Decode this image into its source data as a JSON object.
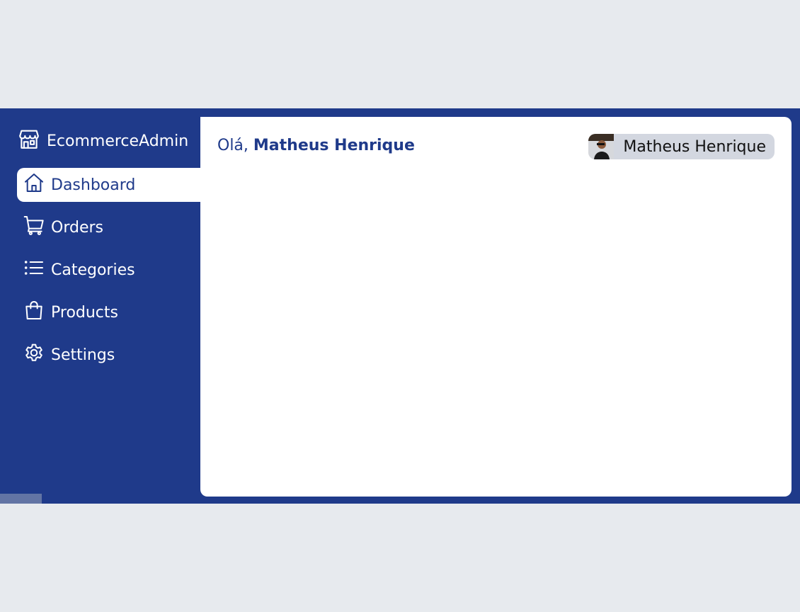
{
  "brand": {
    "name": "EcommerceAdmin",
    "icon": "store-icon"
  },
  "sidebar": {
    "items": [
      {
        "label": "Dashboard",
        "icon": "home-icon",
        "active": true
      },
      {
        "label": "Orders",
        "icon": "cart-icon",
        "active": false
      },
      {
        "label": "Categories",
        "icon": "list-icon",
        "active": false
      },
      {
        "label": "Products",
        "icon": "shopping-bag-icon",
        "active": false
      },
      {
        "label": "Settings",
        "icon": "gear-icon",
        "active": false
      }
    ]
  },
  "header": {
    "greeting_prefix": "Olá,",
    "greeting_name": "Matheus Henrique",
    "user": {
      "name": "Matheus Henrique"
    }
  },
  "colors": {
    "primary": "#1f3a8a",
    "background": "#e7eaee",
    "content": "#ffffff",
    "user_pill": "#d3d7e0"
  }
}
